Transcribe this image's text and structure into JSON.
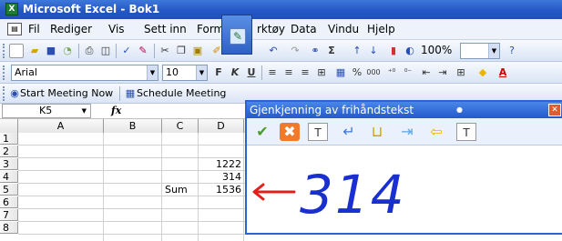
{
  "window": {
    "title": "Microsoft Excel - Bok1",
    "app_icon": "excel-icon"
  },
  "menu": {
    "items": [
      "Fil",
      "Rediger",
      "Vis",
      "Sett inn",
      "Format",
      "Verktøy",
      "Data",
      "Vindu",
      "Hjelp"
    ],
    "visible_items": [
      "Fil",
      "Rediger",
      "Vis",
      "Sett inn",
      "Form",
      "rktøy",
      "Data",
      "Vindu",
      "Hjelp"
    ]
  },
  "toolbar_standard": {
    "icons": [
      "new-icon",
      "open-icon",
      "save-icon",
      "permission-icon",
      "print-icon",
      "print-preview-icon",
      "spelling-icon",
      "research-icon",
      "cut-icon",
      "copy-icon",
      "paste-icon",
      "format-painter-icon",
      "undo-icon",
      "redo-icon",
      "hyperlink-icon",
      "autosum-icon",
      "sort-ascending-icon",
      "sort-descending-icon",
      "chart-wizard-icon",
      "drawing-icon",
      "help-icon"
    ],
    "zoom": "100%",
    "sigma": "Σ"
  },
  "toolbar_formatting": {
    "font": "Arial",
    "size": "10",
    "bold": "F",
    "italic": "K",
    "underline": "U",
    "percent": "%",
    "thousands": "000"
  },
  "toolbar_meeting": {
    "start_meeting": "Start Meeting Now",
    "schedule_meeting": "Schedule Meeting"
  },
  "namebox": {
    "value": "K5",
    "fx": "fx"
  },
  "grid": {
    "columns": [
      "A",
      "B",
      "C",
      "D"
    ],
    "rows": [
      "1",
      "2",
      "3",
      "4",
      "5",
      "6",
      "7",
      "8"
    ],
    "cells": {
      "C5": "Sum",
      "D3": "1222",
      "D4": "314",
      "D5": "1536"
    }
  },
  "handwriting_panel": {
    "title": "Gjenkjenning av frihåndstekst",
    "icons": [
      "spelling-check-icon",
      "delete-icon",
      "insert-text-icon",
      "enter-icon",
      "space-icon",
      "tab-icon",
      "backspace-icon",
      "write-anywhere-icon"
    ],
    "ink_text": "314",
    "ink_color": "#1a2fd0",
    "arrow_color": "#e0201b"
  },
  "colors": {
    "titlebar": "#2558c6",
    "panel_border": "#2c63d3"
  }
}
